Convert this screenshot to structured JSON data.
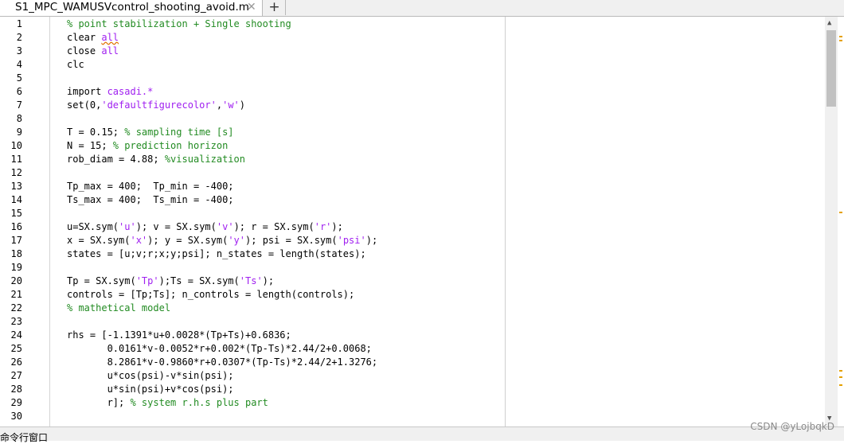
{
  "tab": {
    "title": "S1_MPC_WAMUSVcontrol_shooting_avoid.m",
    "close_glyph": "✕",
    "add_glyph": "+"
  },
  "code_lines": [
    {
      "n": "1",
      "tokens": [
        {
          "t": "% point stabilization + Single shooting",
          "c": "cm"
        }
      ]
    },
    {
      "n": "2",
      "tokens": [
        {
          "t": "clear ",
          "c": ""
        },
        {
          "t": "all",
          "c": "str"
        }
      ]
    },
    {
      "n": "3",
      "tokens": [
        {
          "t": "close ",
          "c": ""
        },
        {
          "t": "all",
          "c": "str"
        }
      ]
    },
    {
      "n": "4",
      "tokens": [
        {
          "t": "clc",
          "c": ""
        }
      ]
    },
    {
      "n": "5",
      "tokens": []
    },
    {
      "n": "6",
      "tokens": [
        {
          "t": "import ",
          "c": ""
        },
        {
          "t": "casadi.*",
          "c": "str"
        }
      ]
    },
    {
      "n": "7",
      "tokens": [
        {
          "t": "set(0,",
          "c": ""
        },
        {
          "t": "'defaultfigurecolor'",
          "c": "str"
        },
        {
          "t": ",",
          "c": ""
        },
        {
          "t": "'w'",
          "c": "str"
        },
        {
          "t": ")",
          "c": ""
        }
      ]
    },
    {
      "n": "8",
      "tokens": []
    },
    {
      "n": "9",
      "tokens": [
        {
          "t": "T = 0.15; ",
          "c": ""
        },
        {
          "t": "% sampling time [s]",
          "c": "cm"
        }
      ]
    },
    {
      "n": "10",
      "tokens": [
        {
          "t": "N = 15; ",
          "c": ""
        },
        {
          "t": "% prediction horizon",
          "c": "cm"
        }
      ]
    },
    {
      "n": "11",
      "tokens": [
        {
          "t": "rob_diam = 4.88; ",
          "c": ""
        },
        {
          "t": "%visualization",
          "c": "cm"
        }
      ]
    },
    {
      "n": "12",
      "tokens": []
    },
    {
      "n": "13",
      "tokens": [
        {
          "t": "Tp_max = 400;  Tp_min = -400;",
          "c": ""
        }
      ]
    },
    {
      "n": "14",
      "tokens": [
        {
          "t": "Ts_max = 400;  Ts_min = -400;",
          "c": ""
        }
      ]
    },
    {
      "n": "15",
      "tokens": []
    },
    {
      "n": "16",
      "tokens": [
        {
          "t": "u=SX.sym(",
          "c": ""
        },
        {
          "t": "'u'",
          "c": "str"
        },
        {
          "t": "); v = SX.sym(",
          "c": ""
        },
        {
          "t": "'v'",
          "c": "str"
        },
        {
          "t": "); r = SX.sym(",
          "c": ""
        },
        {
          "t": "'r'",
          "c": "str"
        },
        {
          "t": ");",
          "c": ""
        }
      ]
    },
    {
      "n": "17",
      "tokens": [
        {
          "t": "x = SX.sym(",
          "c": ""
        },
        {
          "t": "'x'",
          "c": "str"
        },
        {
          "t": "); y = SX.sym(",
          "c": ""
        },
        {
          "t": "'y'",
          "c": "str"
        },
        {
          "t": "); psi = SX.sym(",
          "c": ""
        },
        {
          "t": "'psi'",
          "c": "str"
        },
        {
          "t": ");",
          "c": ""
        }
      ]
    },
    {
      "n": "18",
      "tokens": [
        {
          "t": "states = [u;v;r;x;y;psi]; n_states = length(states);",
          "c": ""
        }
      ]
    },
    {
      "n": "19",
      "tokens": []
    },
    {
      "n": "20",
      "tokens": [
        {
          "t": "Tp = SX.sym(",
          "c": ""
        },
        {
          "t": "'Tp'",
          "c": "str"
        },
        {
          "t": ");Ts = SX.sym(",
          "c": ""
        },
        {
          "t": "'Ts'",
          "c": "str"
        },
        {
          "t": ");",
          "c": ""
        }
      ]
    },
    {
      "n": "21",
      "tokens": [
        {
          "t": "controls = [Tp;Ts]; n_controls = length(controls);",
          "c": ""
        }
      ]
    },
    {
      "n": "22",
      "tokens": [
        {
          "t": "% mathetical model",
          "c": "cm"
        }
      ]
    },
    {
      "n": "23",
      "tokens": []
    },
    {
      "n": "24",
      "tokens": [
        {
          "t": "rhs = [-1.1391*u+0.0028*(Tp+Ts)+0.6836;",
          "c": ""
        }
      ]
    },
    {
      "n": "25",
      "tokens": [
        {
          "t": "       0.0161*v-0.0052*r+0.002*(Tp-Ts)*2.44/2+0.0068;",
          "c": ""
        }
      ]
    },
    {
      "n": "26",
      "tokens": [
        {
          "t": "       8.2861*v-0.9860*r+0.0307*(Tp-Ts)*2.44/2+1.3276;",
          "c": ""
        }
      ]
    },
    {
      "n": "27",
      "tokens": [
        {
          "t": "       u*cos(psi)-v*sin(psi);",
          "c": ""
        }
      ]
    },
    {
      "n": "28",
      "tokens": [
        {
          "t": "       u*sin(psi)+v*cos(psi);",
          "c": ""
        }
      ]
    },
    {
      "n": "29",
      "tokens": [
        {
          "t": "       r]; ",
          "c": ""
        },
        {
          "t": "% system r.h.s plus part",
          "c": "cm"
        }
      ]
    },
    {
      "n": "30",
      "tokens": []
    }
  ],
  "status": {
    "text": "命令行窗口"
  },
  "watermark": "CSDN @yLojbqkD",
  "colors": {
    "keyword": "#0000ff",
    "string": "#a020f0",
    "comment": "#228b22",
    "warning_marker": "#e5a100"
  }
}
